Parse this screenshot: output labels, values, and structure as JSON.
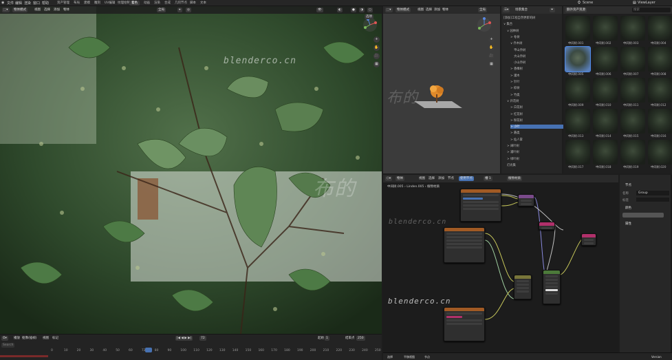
{
  "topbar": {
    "menus": [
      "文件",
      "编辑",
      "渲染",
      "窗口",
      "帮助"
    ],
    "tabs": [
      "资产管理",
      "布局",
      "建模",
      "雕刻",
      "UV编辑",
      "纹理绘制",
      "着色",
      "动画",
      "渲染",
      "合成",
      "几何节点",
      "脚本",
      "文本"
    ],
    "active_tab": "着色",
    "scene": "Scene",
    "view_layer": "ViewLayer"
  },
  "viewport": {
    "mode": "物体模式",
    "menus": [
      "视图",
      "选择",
      "添加",
      "物体"
    ],
    "orientation": "全局",
    "second_row": [
      "选项"
    ],
    "watermarks": [
      "blenderco.cn",
      "布的"
    ],
    "tools": [
      "+",
      "✋",
      "🎥",
      "▦"
    ]
  },
  "timeline": {
    "menus": [
      "播放",
      "抠像(插帧)",
      "视图",
      "标记"
    ],
    "current_frame": "72",
    "start_label": "起始",
    "start": "1",
    "end_label": "结束点",
    "end": "250",
    "numbers": [
      "0",
      "10",
      "20",
      "30",
      "40",
      "50",
      "60",
      "72",
      "80",
      "90",
      "100",
      "110",
      "120",
      "130",
      "140",
      "150",
      "160",
      "170",
      "180",
      "190",
      "200",
      "210",
      "220",
      "230",
      "240",
      "250"
    ],
    "search_placeholder": "Search"
  },
  "viewport2": {
    "mode": "物体模式",
    "menus": [
      "视图",
      "选择",
      "添加",
      "物体"
    ],
    "orientation": "全局",
    "watermark": "布的"
  },
  "outliner": {
    "title": "场景集合",
    "items": [
      {
        "label": "[添加]工程自然更新的树",
        "indent": 0,
        "sel": false
      },
      {
        "label": "∨ 集合",
        "indent": 0,
        "sel": false
      },
      {
        "label": "∨ 园林树",
        "indent": 1,
        "sel": false
      },
      {
        "label": "> 冬树",
        "indent": 2,
        "sel": false
      },
      {
        "label": "∨ 乔木树",
        "indent": 2,
        "sel": false
      },
      {
        "label": "平山乔树",
        "indent": 3,
        "sel": false
      },
      {
        "label": "大山乔树",
        "indent": 3,
        "sel": false
      },
      {
        "label": "小山乔树",
        "indent": 3,
        "sel": false
      },
      {
        "label": "> 香樟树",
        "indent": 2,
        "sel": false
      },
      {
        "label": "> 灌木",
        "indent": 2,
        "sel": false
      },
      {
        "label": "> 针叶",
        "indent": 2,
        "sel": false
      },
      {
        "label": "> 棕树",
        "indent": 2,
        "sel": false
      },
      {
        "label": "> 竹类",
        "indent": 2,
        "sel": false
      },
      {
        "label": "∨ 开花树",
        "indent": 1,
        "sel": false
      },
      {
        "label": "> 白花树",
        "indent": 2,
        "sel": false
      },
      {
        "label": "> 红花树",
        "indent": 2,
        "sel": false
      },
      {
        "label": "> 粉花树",
        "indent": 2,
        "sel": false
      },
      {
        "label": "> 小叶",
        "indent": 2,
        "sel": true
      },
      {
        "label": "> 蕨类",
        "indent": 2,
        "sel": false
      },
      {
        "label": "> 仙人掌",
        "indent": 2,
        "sel": false
      },
      {
        "label": "> 阔叶树",
        "indent": 1,
        "sel": false
      },
      {
        "label": "> 灌叶树",
        "indent": 1,
        "sel": false
      },
      {
        "label": "> 绿叶树",
        "indent": 1,
        "sel": false
      },
      {
        "label": "灯光集",
        "indent": 1,
        "sel": false
      }
    ]
  },
  "assets": {
    "library": "额外资产资源",
    "search_placeholder": "搜索",
    "thumbs": [
      "中间树.001",
      "中间树.002",
      "中间树.003",
      "中间树.004",
      "中间树.005",
      "中间树.006",
      "中间树.007",
      "中间树.008",
      "中间树.009",
      "中间树.010",
      "中间树.011",
      "中间树.012",
      "中间树.013",
      "中间树.014",
      "中间树.015",
      "中间树.016",
      "中间树.017",
      "中间树.018",
      "中间树.019",
      "中间树.020"
    ],
    "selected_index": 4
  },
  "nodes": {
    "menus": [
      "物体",
      "视图",
      "选择",
      "添加",
      "节点"
    ],
    "use_nodes": "使用节点",
    "slot": "槽 1",
    "material": "植物材质",
    "breadcrumb": [
      "中间树.005",
      "Linden.005",
      "植物材质"
    ],
    "watermarks": [
      "blenderco.cn",
      "blenderco.cn",
      "布的"
    ]
  },
  "properties": {
    "header": "节点",
    "name_label": "名称",
    "name_value": "Group",
    "label_label": "标签",
    "color_label": "颜色",
    "props_label": "属性"
  },
  "status": {
    "items": [
      "选择",
      "平移视图",
      "节点"
    ],
    "right": [
      "Version"
    ]
  },
  "colors": {
    "accent": "#4772b3",
    "bg": "#1d1d1d",
    "node_orange": "#a15a24",
    "node_purple": "#7a4a8a",
    "node_green": "#4c7a3a",
    "node_pink": "#b0306a",
    "node_olive": "#79763a"
  }
}
